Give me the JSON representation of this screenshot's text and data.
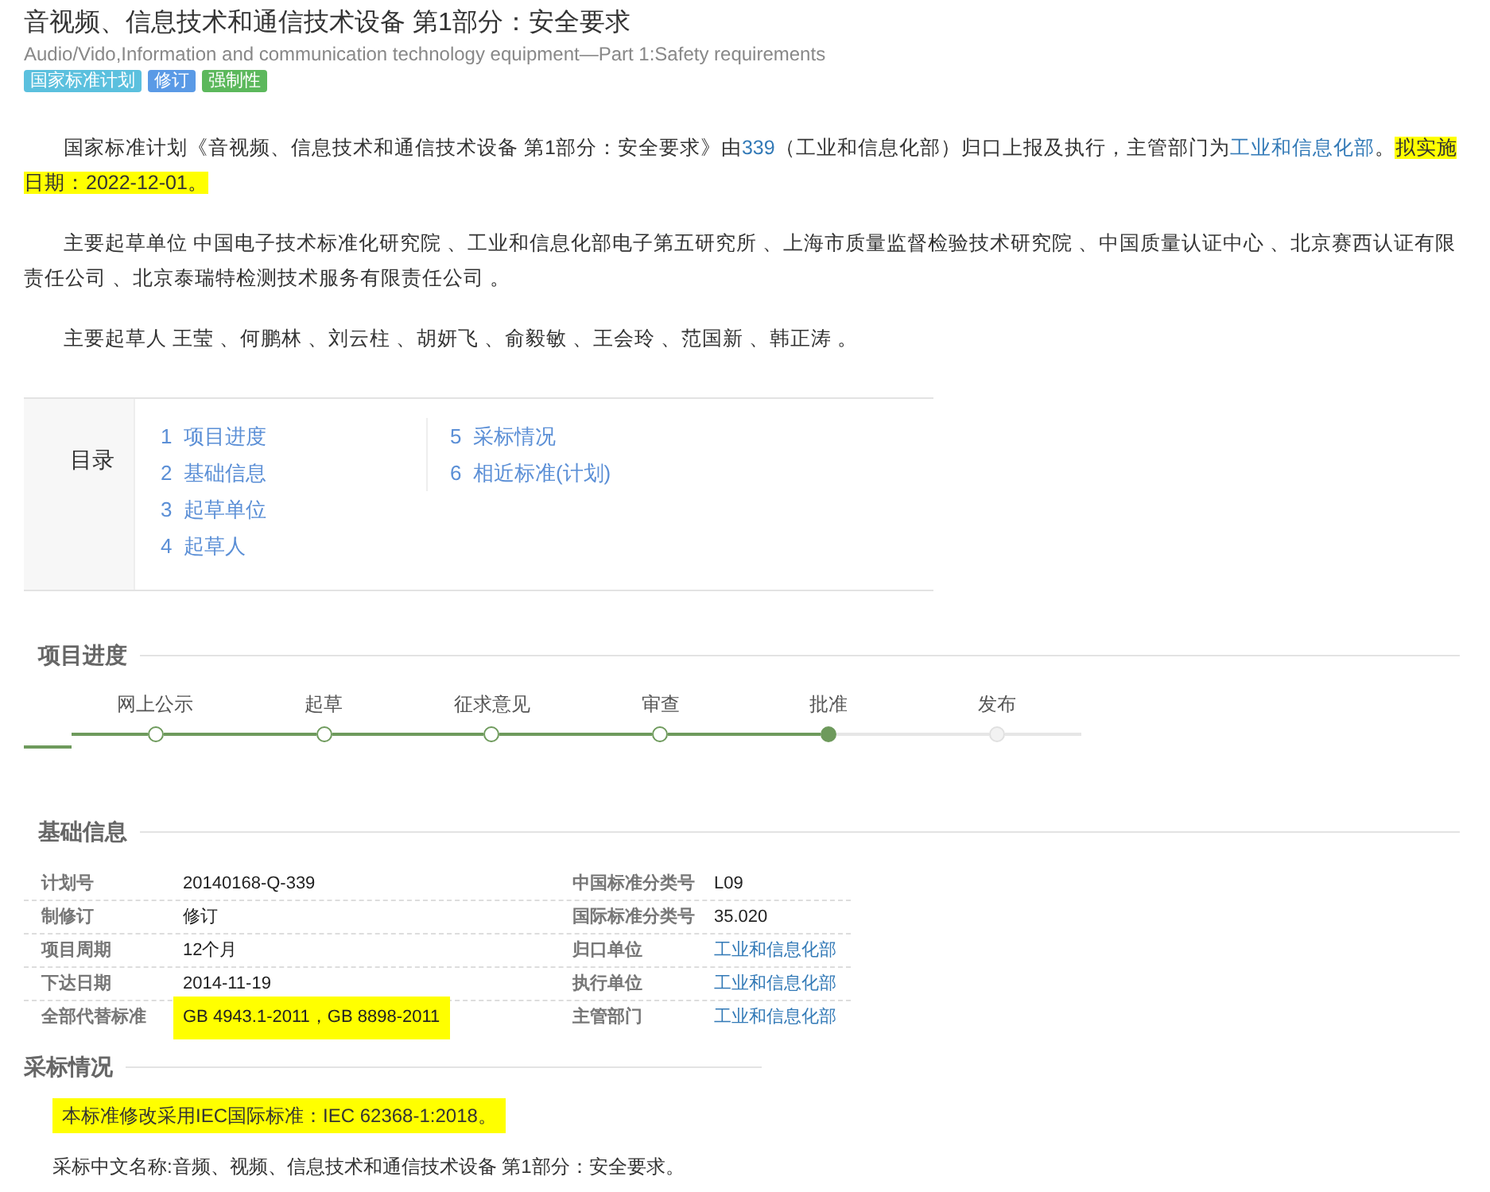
{
  "title": "音视频、信息技术和通信技术设备 第1部分：安全要求",
  "subtitle": "Audio/Vido,Information and communication technology equipment—Part 1:Safety requirements",
  "tags": [
    {
      "label": "国家标准计划",
      "color": "#5bc0de"
    },
    {
      "label": "修订",
      "color": "#5a9ae6"
    },
    {
      "label": "强制性",
      "color": "#5cb85c"
    }
  ],
  "paragraphs": [
    [
      {
        "text": "国家标准计划《音视频、信息技术和通信技术设备 第1部分：安全要求》由",
        "link": false,
        "highlighted": false
      },
      {
        "text": "339",
        "link": true,
        "highlighted": false
      },
      {
        "text": "（工业和信息化部）归口上报及执行，主管部门为",
        "link": false,
        "highlighted": false
      },
      {
        "text": "工业和信息化部",
        "link": true,
        "highlighted": false
      },
      {
        "text": "。",
        "link": false,
        "highlighted": false
      },
      {
        "text": "拟实施日期：2022-12-01。",
        "link": false,
        "highlighted": true
      }
    ],
    [
      {
        "text": "主要起草单位 中国电子技术标准化研究院 、工业和信息化部电子第五研究所 、上海市质量监督检验技术研究院 、中国质量认证中心 、北京赛西认证有限责任公司 、北京泰瑞特检测技术服务有限责任公司 。",
        "link": false,
        "highlighted": false
      }
    ],
    [
      {
        "text": "主要起草人 王莹 、何鹏林 、刘云柱 、胡妍飞 、俞毅敏 、王会玲 、范国新 、韩正涛 。",
        "link": false,
        "highlighted": false
      }
    ]
  ],
  "toc": {
    "title": "目录",
    "columns": [
      [
        {
          "number": "1",
          "label": "项目进度"
        },
        {
          "number": "2",
          "label": "基础信息"
        },
        {
          "number": "3",
          "label": "起草单位"
        },
        {
          "number": "4",
          "label": "起草人"
        }
      ],
      [
        {
          "number": "5",
          "label": "采标情况"
        },
        {
          "number": "6",
          "label": "相近标准(计划)"
        }
      ]
    ]
  },
  "progress": {
    "heading": "项目进度",
    "steps": [
      {
        "label": "网上公示",
        "done": true,
        "current": false
      },
      {
        "label": "起草",
        "done": true,
        "current": false
      },
      {
        "label": "征求意见",
        "done": true,
        "current": false
      },
      {
        "label": "审查",
        "done": true,
        "current": false
      },
      {
        "label": "批准",
        "done": true,
        "current": true
      },
      {
        "label": "发布",
        "done": false,
        "current": false
      }
    ]
  },
  "basic_info": {
    "heading": "基础信息",
    "rows": [
      [
        {
          "label": "计划号",
          "value": "20140168-Q-339",
          "link": false,
          "highlighted": false
        },
        {
          "label": "中国标准分类号",
          "value": "L09",
          "link": false,
          "highlighted": false
        }
      ],
      [
        {
          "label": "制修订",
          "value": "修订",
          "link": false,
          "highlighted": false
        },
        {
          "label": "国际标准分类号",
          "value": "35.020",
          "link": false,
          "highlighted": false
        }
      ],
      [
        {
          "label": "项目周期",
          "value": "12个月",
          "link": false,
          "highlighted": false
        },
        {
          "label": "归口单位",
          "value": "工业和信息化部",
          "link": true,
          "highlighted": false
        }
      ],
      [
        {
          "label": "下达日期",
          "value": "2014-11-19",
          "link": false,
          "highlighted": false
        },
        {
          "label": "执行单位",
          "value": "工业和信息化部",
          "link": true,
          "highlighted": false
        }
      ],
      [
        {
          "label": "全部代替标准",
          "value": "GB 4943.1-2011，GB 8898-2011",
          "link": false,
          "highlighted": true
        },
        {
          "label": "主管部门",
          "value": "工业和信息化部",
          "link": true,
          "highlighted": false
        }
      ]
    ]
  },
  "adoption": {
    "heading": "采标情况",
    "lines": [
      {
        "text": "本标准修改采用IEC国际标准：IEC 62368-1:2018。",
        "highlighted": true
      },
      {
        "text": "采标中文名称:音频、视频、信息技术和通信技术设备 第1部分：安全要求。",
        "highlighted": false
      }
    ]
  }
}
